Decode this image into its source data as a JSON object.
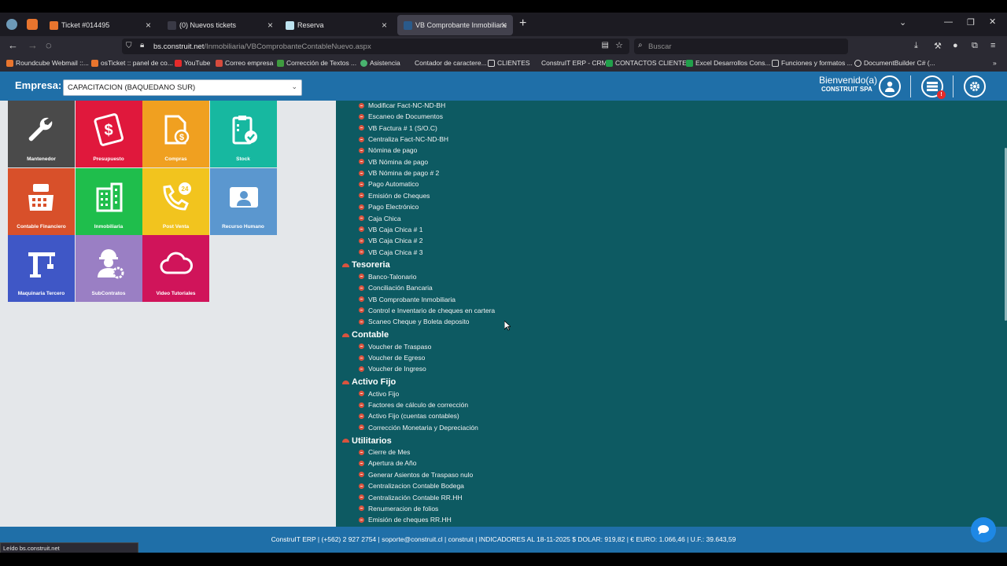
{
  "browser": {
    "tabs": [
      {
        "label": "Ticket #014495"
      },
      {
        "label": "(0) Nuevos tickets"
      },
      {
        "label": "Reserva"
      },
      {
        "label": "VB Comprobante Inmobiliaria"
      }
    ],
    "url_host": "bs.construit.net",
    "url_path": "/Inmobiliaria/VBComprobanteContableNuevo.aspx",
    "search_placeholder": "Buscar",
    "bookmarks": [
      "Roundcube Webmail ::...",
      "osTicket :: panel de co...",
      "YouTube",
      "Correo empresa",
      "Corrección de Textos ...",
      "Asistencia",
      "Contador de caractere...",
      "CLIENTES",
      "ConstruIT ERP - CRM",
      "CONTACTOS CLIENTES",
      "Excel Desarrollos Cons...",
      "Funciones y formatos ...",
      "DocumentBuilder C# (..."
    ],
    "status_text": "Leído bs.construit.net"
  },
  "header": {
    "empresa_label": "Empresa:",
    "empresa_value": "CAPACITACION (BAQUEDANO SUR)",
    "welcome": "Bienvenido(a)",
    "company": "CONSTRUIT SPA",
    "badge": "!"
  },
  "tiles": [
    {
      "label": "Mantenedor",
      "color": "#4a4a4a",
      "icon": "wrench-icon"
    },
    {
      "label": "Presupuesto",
      "color": "#e0183c",
      "icon": "money-icon"
    },
    {
      "label": "Compras",
      "color": "#f0a020",
      "icon": "document-dollar-icon"
    },
    {
      "label": "Stock",
      "color": "#17b8a0",
      "icon": "clipboard-check-icon"
    },
    {
      "label": "Contable Financiero",
      "color": "#d8502a",
      "icon": "cash-register-icon"
    },
    {
      "label": "Inmobiliaria",
      "color": "#1fbe4c",
      "icon": "building-icon"
    },
    {
      "label": "Post Venta",
      "color": "#f2c41e",
      "icon": "phone-24-icon"
    },
    {
      "label": "Recurso Humano",
      "color": "#5b97cf",
      "icon": "id-card-icon"
    },
    {
      "label": "Maquinaria Tercero",
      "color": "#3f57c6",
      "icon": "crane-icon"
    },
    {
      "label": "SubContratos",
      "color": "#9a7fc4",
      "icon": "worker-gear-icon"
    },
    {
      "label": "Video Tutoriales",
      "color": "#d0145a",
      "icon": "cloud-icon"
    }
  ],
  "menu": {
    "top_items": [
      "Modificar Fact-NC-ND-BH",
      "Escaneo de Documentos",
      "VB Factura # 1 (S/O.C)",
      "Centraliza Fact-NC-ND-BH",
      "Nómina de pago",
      "VB Nómina de pago",
      "VB Nómina de pago # 2",
      "Pago Automatico",
      "Emisión de Cheques",
      "Pago Electrónico",
      "Caja Chica",
      "VB Caja Chica # 1",
      "VB Caja Chica # 2",
      "VB Caja Chica # 3"
    ],
    "sections": [
      {
        "title": "Tesoreria",
        "items": [
          "Banco-Talonario",
          "Conciliación Bancaria",
          "VB Comprobante Inmobiliaria",
          "Control e Inventario de cheques en cartera",
          "Scaneo Cheque y Boleta deposito"
        ]
      },
      {
        "title": "Contable",
        "items": [
          "Voucher de Traspaso",
          "Voucher de Egreso",
          "Voucher de Ingreso"
        ]
      },
      {
        "title": "Activo Fijo",
        "items": [
          "Activo Fijo",
          "Factores de cálculo de corrección",
          "Activo Fijo (cuentas contables)",
          "Corrección Monetaria y Depreciación"
        ]
      },
      {
        "title": "Utilitarios",
        "items": [
          "Cierre de Mes",
          "Apertura de Año",
          "Generar Asientos de Traspaso nulo",
          "Centralizacion Contable Bodega",
          "Centralización Contable RR.HH",
          "Renumeracion de folios",
          "Emisión de cheques RR.HH"
        ]
      }
    ]
  },
  "footer": {
    "text": "ConstruIT ERP | (+562) 2 927 2754 | soporte@construit.cl | construit | INDICADORES AL 18-11-2025 $ DOLAR: 919,82 | € EURO: 1.066,46 | U.F.: 39.643,59"
  }
}
